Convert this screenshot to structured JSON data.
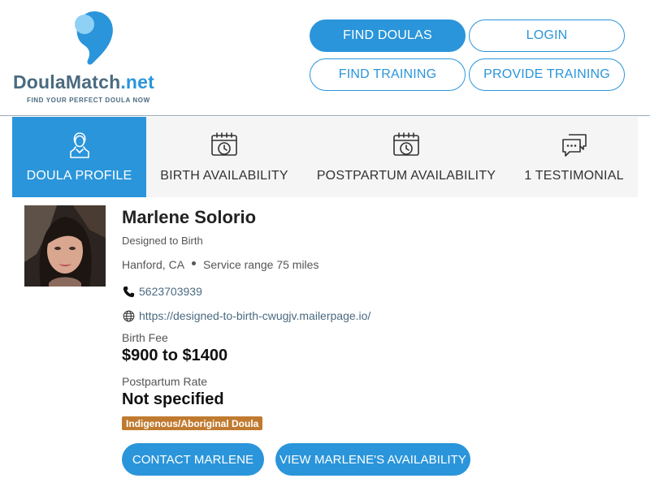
{
  "logo": {
    "name_part1": "Doula",
    "name_part2": "Match",
    "name_part3": ".net",
    "tagline": "FIND YOUR PERFECT DOULA NOW"
  },
  "nav": {
    "find_doulas": "FIND DOULAS",
    "login": "LOGIN",
    "find_training": "FIND TRAINING",
    "provide_training": "PROVIDE TRAINING"
  },
  "tabs": [
    {
      "label": "DOULA PROFILE",
      "icon": "person-icon",
      "active": true
    },
    {
      "label": "BIRTH AVAILABILITY",
      "icon": "calendar-clock-icon",
      "active": false
    },
    {
      "label": "POSTPARTUM AVAILABILITY",
      "icon": "calendar-clock-icon",
      "active": false
    },
    {
      "label": "1 TESTIMONIAL",
      "icon": "chat-bubbles-icon",
      "active": false
    }
  ],
  "profile": {
    "name": "Marlene Solorio",
    "business": "Designed to Birth",
    "city": "Hanford, CA",
    "service_range": "Service range 75 miles",
    "phone": "5623703939",
    "website": "https://designed-to-birth-cwugjv.mailerpage.io/",
    "birth_fee_label": "Birth Fee",
    "birth_fee": "$900 to $1400",
    "postpartum_label": "Postpartum Rate",
    "postpartum_rate": "Not specified",
    "badge": "Indigenous/Aboriginal Doula"
  },
  "actions": {
    "contact": "CONTACT MARLENE",
    "availability": "VIEW MARLENE'S AVAILABILITY"
  },
  "colors": {
    "accent": "#2a95da",
    "badge": "#c07a2f",
    "tab_bg": "#f5f5f5"
  }
}
